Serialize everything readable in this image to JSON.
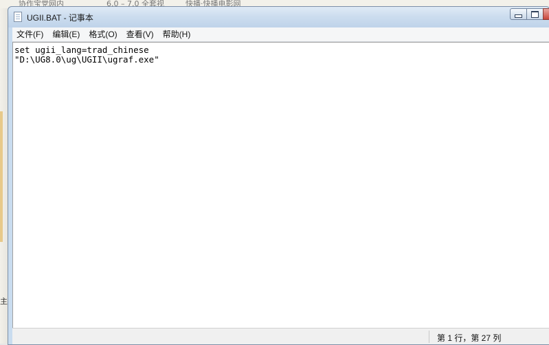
{
  "background": {
    "strip_items": [
      "协作宝党网内",
      "6.0 – 7.0 全套视",
      "快播·快播电影网"
    ],
    "left_fragments": [
      "主"
    ]
  },
  "window": {
    "title": "UGII.BAT - 记事本"
  },
  "menu": {
    "items": [
      "文件(F)",
      "编辑(E)",
      "格式(O)",
      "查看(V)",
      "帮助(H)"
    ]
  },
  "editor": {
    "lines": [
      "set ugii_lang=trad_chinese",
      "\"D:\\UG8.0\\ug\\UGII\\ugraf.exe\""
    ]
  },
  "status": {
    "position": "第 1 行，第 27 列"
  }
}
